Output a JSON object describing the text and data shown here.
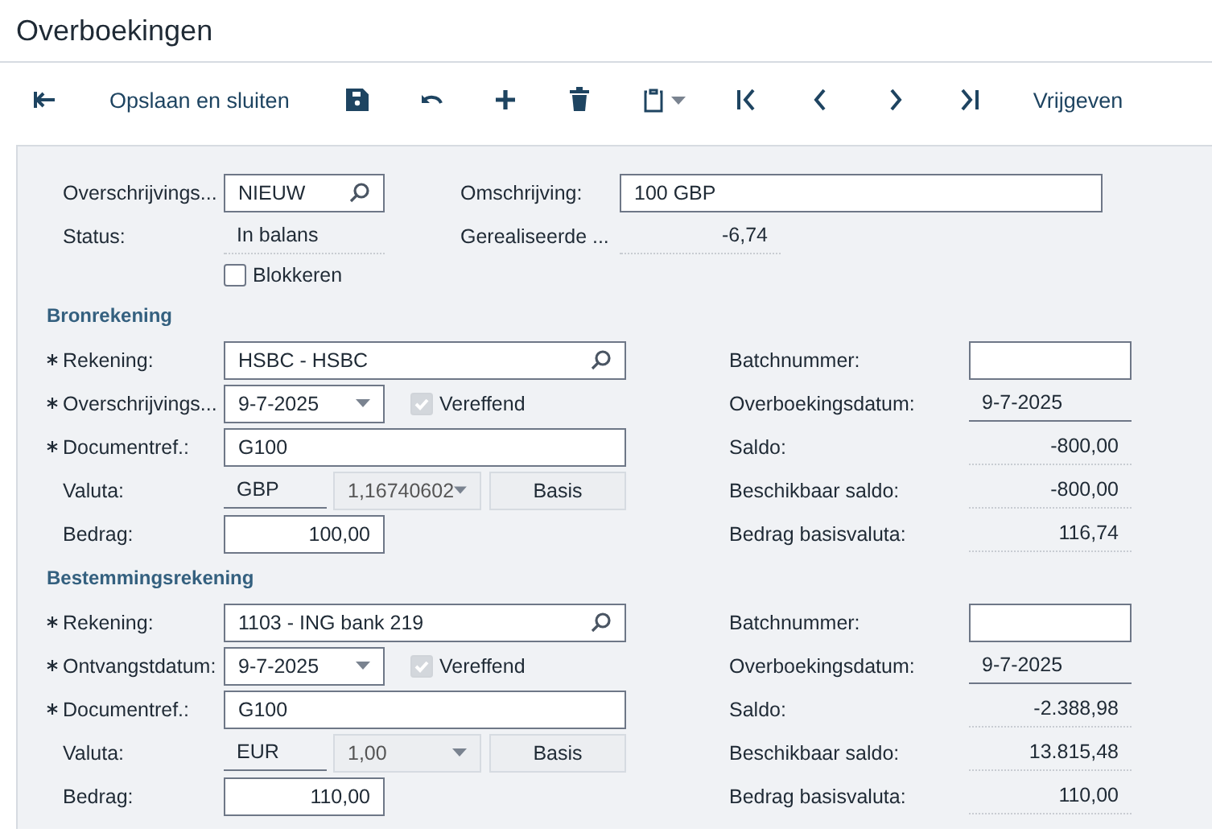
{
  "window": {
    "title": "Overboekingen"
  },
  "toolbar": [
    {
      "kind": "back"
    },
    {
      "kind": "text",
      "label": "Opslaan en sluiten"
    },
    {
      "kind": "save"
    },
    {
      "kind": "undo"
    },
    {
      "kind": "add"
    },
    {
      "kind": "delete"
    },
    {
      "kind": "clipboard"
    },
    {
      "kind": "first"
    },
    {
      "kind": "prev"
    },
    {
      "kind": "next"
    },
    {
      "kind": "last"
    },
    {
      "kind": "text",
      "label": "Vrijgeven"
    }
  ],
  "header": {
    "number": {
      "label": "Overschrijvings...",
      "value": "NIEUW"
    },
    "description": {
      "label": "Omschrijving:",
      "value": "100 GBP"
    },
    "status": {
      "label": "Status:",
      "value": "In balans"
    },
    "realized": {
      "label": "Gerealiseerde ...",
      "value": "-6,74"
    },
    "hold": {
      "label": "Blokkeren",
      "checked": false
    }
  },
  "sections": [
    {
      "title": "Bronrekening",
      "left": [
        {
          "kind": "lookup",
          "label": "Rekening:",
          "required": true,
          "value": "HSBC - HSBC"
        },
        {
          "kind": "date",
          "label": "Overschrijvings...",
          "required": true,
          "value": "9-7-2025",
          "checkbox": {
            "label": "Vereffend",
            "checked": true,
            "disabled": true
          }
        },
        {
          "kind": "text",
          "label": "Documentref.:",
          "required": true,
          "value": "G100"
        },
        {
          "kind": "currency",
          "label": "Valuta:",
          "required": false,
          "value": "GBP",
          "rate": "1,16740602",
          "button": "Basis"
        },
        {
          "kind": "amount",
          "label": "Bedrag:",
          "required": false,
          "value": "100,00"
        }
      ],
      "right": [
        {
          "kind": "box",
          "label": "Batchnummer:"
        },
        {
          "kind": "underline",
          "label": "Overboekingsdatum:",
          "value": "9-7-2025"
        },
        {
          "kind": "readonly",
          "label": "Saldo:",
          "value": "-800,00"
        },
        {
          "kind": "readonly",
          "label": "Beschikbaar saldo:",
          "value": "-800,00"
        },
        {
          "kind": "readonly",
          "label": "Bedrag basisvaluta:",
          "value": "116,74"
        }
      ]
    },
    {
      "title": "Bestemmingsrekening",
      "left": [
        {
          "kind": "lookup",
          "label": "Rekening:",
          "required": true,
          "value": "1103 - ING bank 219"
        },
        {
          "kind": "date",
          "label": "Ontvangstdatum:",
          "required": true,
          "value": "9-7-2025",
          "checkbox": {
            "label": "Vereffend",
            "checked": true,
            "disabled": true
          }
        },
        {
          "kind": "text",
          "label": "Documentref.:",
          "required": true,
          "value": "G100"
        },
        {
          "kind": "currency",
          "label": "Valuta:",
          "required": false,
          "value": "EUR",
          "rate": "1,00",
          "button": "Basis"
        },
        {
          "kind": "amount",
          "label": "Bedrag:",
          "required": false,
          "value": "110,00"
        }
      ],
      "right": [
        {
          "kind": "box",
          "label": "Batchnummer:"
        },
        {
          "kind": "underline",
          "label": "Overboekingsdatum:",
          "value": "9-7-2025"
        },
        {
          "kind": "readonly",
          "label": "Saldo:",
          "value": "-2.388,98"
        },
        {
          "kind": "readonly",
          "label": "Beschikbaar saldo:",
          "value": "13.815,48"
        },
        {
          "kind": "readonly",
          "label": "Bedrag basisvaluta:",
          "value": "110,00"
        }
      ]
    }
  ]
}
